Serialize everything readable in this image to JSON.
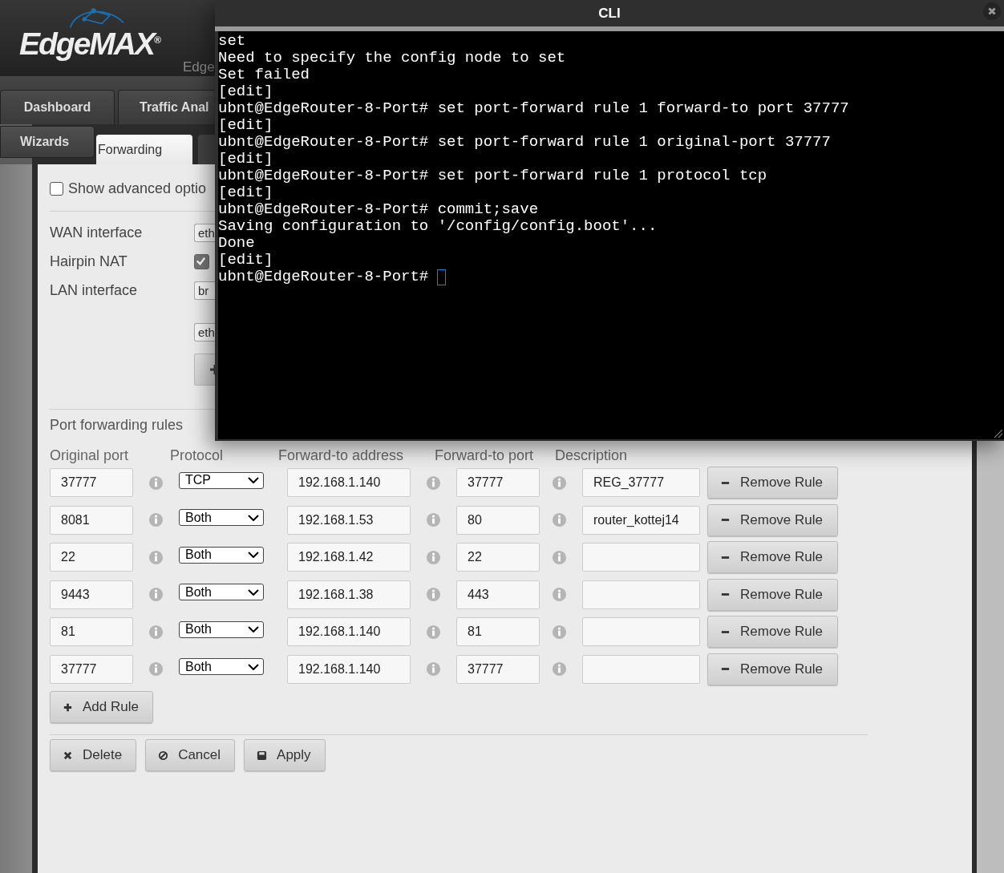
{
  "header": {
    "logo": "EdgeMAX$^{®}$",
    "subtitle": "Edge"
  },
  "nav_tabs": [
    {
      "label": "Dashboard",
      "selected": false
    },
    {
      "label": "Traffic Anal",
      "selected": false
    }
  ],
  "wizards_tab": {
    "label": "Wizards"
  },
  "page_tabs": [
    {
      "label": "Forwarding",
      "selected": true
    }
  ],
  "advanced": {
    "label": "Show advanced optio",
    "checked": false
  },
  "settings": [
    {
      "kind": "field",
      "label": "WAN interface",
      "value": "eth"
    },
    {
      "kind": "checkbox",
      "label": "Hairpin NAT",
      "checked": true
    },
    {
      "kind": "field",
      "label": "LAN interface",
      "value": "br"
    },
    {
      "kind": "field",
      "value": "eth"
    },
    {
      "kind": "add"
    }
  ],
  "rules": {
    "title": "Port forwarding rules",
    "columns": [
      "Original port",
      "Protocol",
      "Forward-to address",
      "Forward-to port",
      "Description"
    ],
    "rows": [
      {
        "original_port": "37777",
        "protocol": "TCP",
        "address": "192.168.1.140",
        "forward_port": "37777",
        "description": "REG_37777",
        "action": "Remove Rule"
      },
      {
        "original_port": "8081",
        "protocol": "Both",
        "address": "192.168.1.53",
        "forward_port": "80",
        "description": "router_kottej14",
        "action": "Remove Rule"
      },
      {
        "original_port": "22",
        "protocol": "Both",
        "address": "192.168.1.42",
        "forward_port": "22",
        "action": "Remove Rule"
      },
      {
        "original_port": "9443",
        "protocol": "Both",
        "address": "192.168.1.38",
        "forward_port": "443",
        "action": "Remove Rule"
      },
      {
        "original_port": "81",
        "protocol": "Both",
        "address": "192.168.1.140",
        "forward_port": "81",
        "action": "Remove Rule"
      },
      {
        "original_port": "37777",
        "protocol": "Both",
        "address": "192.168.1.140",
        "forward_port": "37777",
        "action": "Remove Rule"
      }
    ],
    "add_button": "Add Rule"
  },
  "actions": [
    {
      "kind": "delete",
      "label": "Delete"
    },
    {
      "kind": "cancel",
      "label": "Cancel"
    },
    {
      "kind": "apply",
      "label": "Apply"
    }
  ],
  "cli": {
    "title": "CLI",
    "cursor_visible": true,
    "lines": [
      "set",
      "Need to specify the config node to set",
      "Set failed",
      "[edit]",
      "ubnt@EdgeRouter-8-Port# set port-forward rule 1 forward-to port 37777",
      "[edit]",
      "ubnt@EdgeRouter-8-Port# set port-forward rule 1 original-port 37777",
      "[edit]",
      "ubnt@EdgeRouter-8-Port# set port-forward rule 1 protocol tcp",
      "[edit]",
      "ubnt@EdgeRouter-8-Port# commit;save",
      "Saving configuration to '/config/config.boot'...",
      "Done",
      "[edit]",
      "ubnt@EdgeRouter-8-Port#"
    ]
  }
}
